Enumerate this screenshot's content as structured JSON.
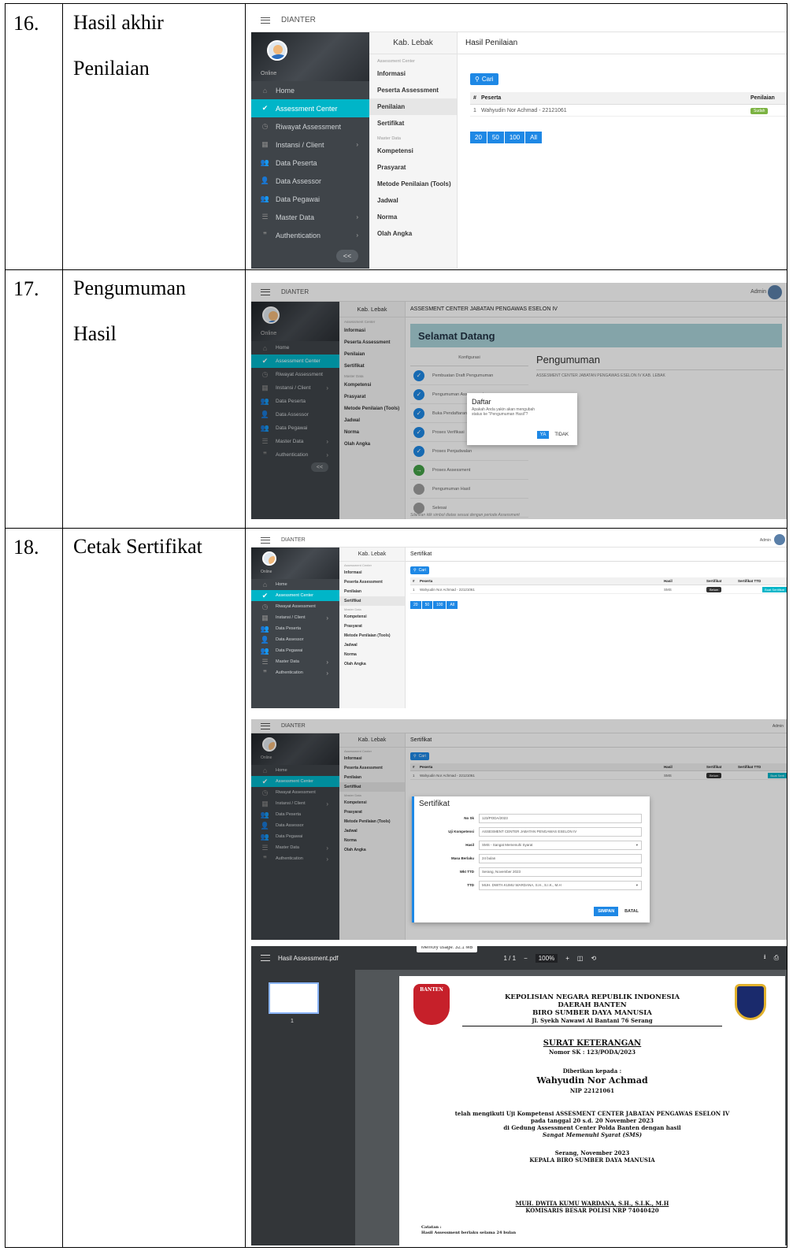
{
  "rows": [
    {
      "num": "16.",
      "label": "Hasil akhir\nPenilaian"
    },
    {
      "num": "17.",
      "label": "Pengumuman\nHasil"
    },
    {
      "num": "18.",
      "label": "Cetak Sertifikat"
    }
  ],
  "app": {
    "name": "DIANTER",
    "online": "Online",
    "admin": "Admin",
    "collapse": "<<",
    "region": "Kab. Lebak",
    "sidebar": [
      "Home",
      "Assessment Center",
      "Riwayat Assessment",
      "Instansi / Client",
      "Data Peserta",
      "Data Assessor",
      "Data Pegawai",
      "Master Data",
      "Authentication"
    ],
    "submenu_head1": "Assessment Center",
    "submenu_head2": "Master Data",
    "submenu": [
      "Informasi",
      "Peserta Assessment",
      "Penilaian",
      "Sertifikat",
      "Kompetensi",
      "Prasyarat",
      "Metode Penilaian (Tools)",
      "Jadwal",
      "Norma",
      "Olah Angka"
    ]
  },
  "s16": {
    "title": "Hasil Penilaian",
    "search": "Cari",
    "col_no": "#",
    "col_peserta": "Peserta",
    "col_penilaian": "Penilaian",
    "row_no": "1",
    "row_peserta": "Wahyudin Nor Achmad - 22121061",
    "badge": "Sudah",
    "pages": [
      "20",
      "50",
      "100",
      "All"
    ]
  },
  "s17": {
    "header": "ASSESMENT CENTER JABATAN PENGAWAS ESELON IV",
    "welcome": "Selamat Datang",
    "konfigurasi": "Konfigurasi",
    "steps": [
      "Pembuatan Draft Pengumuman",
      "Pengumuman Assessment",
      "Buka Pendaftaran",
      "Proses Verifikasi",
      "Proses Penjadwalan",
      "Proses Assessment",
      "Pengumuman Hasil",
      "Selesai"
    ],
    "pengumuman_title": "Pengumuman",
    "pengumuman_text": "ASSESMENT CENTER JABATAN PENGAWAS ESELON IV KAB. LEBAK",
    "dialog_title": "Daftar",
    "dialog_text": "Apakah Anda yakin akan mengubah status ke \"Pengumuman Hasil\"?",
    "yes": "YA",
    "no": "TIDAK",
    "footer": "Silahkan klik simbol diatas sesuai dengan periode Assessment"
  },
  "s18a": {
    "title": "Sertifikat",
    "search": "Cari",
    "cols": [
      "#",
      "Peserta",
      "Hasil",
      "Sertifikat",
      "Sertifikat TTD"
    ],
    "row_no": "1",
    "row_peserta": "Wahyudin Nor Achmad - 22121061",
    "row_hasil": "SMS",
    "row_badge": "Belum",
    "buat": "Buat Sertifikat",
    "pages": [
      "20",
      "50",
      "100",
      "All"
    ]
  },
  "s18b": {
    "buat": "Buat Serti",
    "form_title": "Sertifikat",
    "fields": [
      {
        "label": "No Sk",
        "value": "123/PODA/2023",
        "select": false
      },
      {
        "label": "Uji Kompetensi",
        "value": "ASSESMENT CENTER JABATAN PENGAWAS ESELON IV",
        "select": false
      },
      {
        "label": "Hasil",
        "value": "SMS - Sangat Memenuhi Syarat",
        "select": true
      },
      {
        "label": "Masa Berlaku",
        "value": "24 bulan",
        "select": false
      },
      {
        "label": "Wkt TTD",
        "value": "Serang, November 2023",
        "select": false
      },
      {
        "label": "TTD",
        "value": "MUH. DWITA KUMU WARDANA, S.H., S.I.K., M.H",
        "select": true
      }
    ],
    "save": "SIMPAN",
    "cancel": "BATAL"
  },
  "pdf": {
    "filename": "Hasil Assessment.pdf",
    "memory": "Memory usage: 32.1 MB",
    "page": "1 / 1",
    "zoom": "100%",
    "thumb_no": "1",
    "banten": "BANTEN",
    "org1": "KEPOLISIAN NEGARA REPUBLIK INDONESIA",
    "org2": "DAERAH BANTEN",
    "org3": "BIRO SUMBER DAYA MANUSIA",
    "address": "Jl. Syekh Nawawi Al Bantani 76 Serang",
    "doc_title": "SURAT KETERANGAN",
    "nomor": "Nomor SK : 123/PODA/2023",
    "diberikan": "Diberikan kepada :",
    "name": "Wahyudin Nor Achmad",
    "nip": "NIP 22121061",
    "line1": "telah mengikuti Uji Kompetensi ASSESMENT CENTER JABATAN PENGAWAS ESELON IV",
    "line2": "pada tanggal 20 s.d. 20 November 2023",
    "line3": "di Gedung Assessment Center Polda Banten dengan hasil",
    "line4": "Sangat Memenuhi Syarat (SMS)",
    "place_date": "Serang, November 2023",
    "sign_title": "KEPALA BIRO SUMBER DAYA MANUSIA",
    "signer": "MUH. DWITA KUMU WARDANA, S.H., S.I.K., M.H",
    "rank": "KOMISARIS BESAR POLISI NRP 74040420",
    "catatan": "Catatan :",
    "note": "Hasil Assessment berlaku selama 24 bulan"
  }
}
